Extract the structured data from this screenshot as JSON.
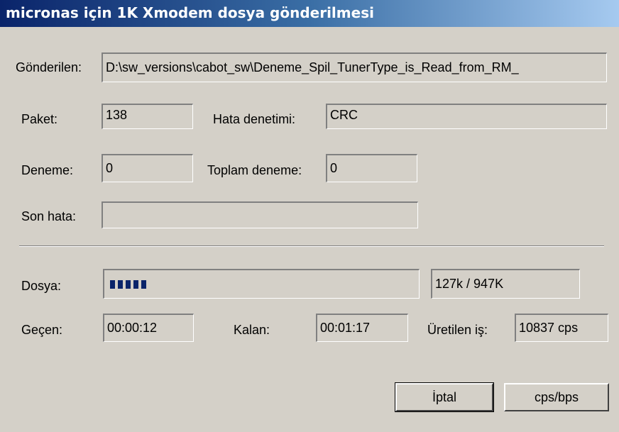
{
  "window": {
    "title": "micronas için 1K Xmodem dosya gönderilmesi"
  },
  "sending": {
    "label": "Gönderilen:",
    "value": "D:\\sw_versions\\cabot_sw\\Deneme_Spil_TunerType_is_Read_from_RM_"
  },
  "packet": {
    "label": "Paket:",
    "value": "138"
  },
  "error_check": {
    "label": "Hata denetimi:",
    "value": "CRC"
  },
  "retry": {
    "label": "Deneme:",
    "value": "0"
  },
  "total_retry": {
    "label": "Toplam deneme:",
    "value": "0"
  },
  "last_error": {
    "label": "Son hata:",
    "value": ""
  },
  "file": {
    "label": "Dosya:",
    "progress_fraction": 0.134,
    "size_text": "127k / 947K"
  },
  "elapsed": {
    "label": "Geçen:",
    "value": "00:00:12"
  },
  "remaining": {
    "label": "Kalan:",
    "value": "00:01:17"
  },
  "throughput": {
    "label": "Üretilen iş:",
    "value": "10837 cps"
  },
  "buttons": {
    "cancel": "İptal",
    "cps_bps": "cps/bps"
  },
  "colors": {
    "title_start": "#0a246a",
    "title_end": "#a6caf0",
    "progress": "#0a246a",
    "face": "#d4d0c8"
  }
}
